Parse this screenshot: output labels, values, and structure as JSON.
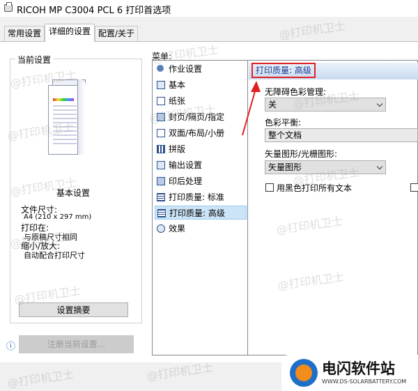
{
  "window": {
    "title": "RICOH MP C3004 PCL 6 打印首选项"
  },
  "tabs": [
    {
      "label": "常用设置",
      "active": false
    },
    {
      "label": "详细的设置",
      "active": true
    },
    {
      "label": "配置/关于",
      "active": false
    }
  ],
  "current_settings": {
    "group_title": "当前设置",
    "preview_caption": "基本设置",
    "info": [
      "文件尺寸:",
      "A4 (210 x 297 mm)",
      "打印在:",
      "与原稿尺寸相同",
      "缩小/放大:",
      "自动配合打印尺寸"
    ],
    "summary_button": "设置摘要",
    "register_button": "注册当前设置...",
    "info_icon": "ⓘ"
  },
  "menu": {
    "label": "菜单:",
    "items": [
      {
        "label": "作业设置",
        "icon": "job-icon"
      },
      {
        "label": "基本",
        "icon": "basic-icon"
      },
      {
        "label": "纸张",
        "icon": "paper-icon"
      },
      {
        "label": "封页/隔页/指定",
        "icon": "cover-icon"
      },
      {
        "label": "双面/布局/小册",
        "icon": "duplex-icon"
      },
      {
        "label": "拼版",
        "icon": "imposition-icon"
      },
      {
        "label": "输出设置",
        "icon": "output-icon"
      },
      {
        "label": "印后处理",
        "icon": "finishing-icon"
      },
      {
        "label": "打印质量: 标准",
        "icon": "quality-standard-icon"
      },
      {
        "label": "打印质量: 高级",
        "icon": "quality-advanced-icon",
        "selected": true
      },
      {
        "label": "效果",
        "icon": "effect-icon"
      }
    ]
  },
  "detail": {
    "title": "打印质量: 高级",
    "fields": [
      {
        "label": "无障碍色彩管理:",
        "value": "关"
      },
      {
        "label": "色彩平衡:",
        "value": "整个文档"
      },
      {
        "label": "矢量图形/光栅图形:",
        "value": "矢量图形"
      }
    ],
    "checkbox": {
      "label": "用黑色打印所有文本",
      "checked": false
    }
  },
  "colors": {
    "highlight_border": "#e02020",
    "selection": "#cce4f7",
    "brand_blue": "#1f6fc9",
    "brand_orange": "#f28c1a"
  },
  "watermark": {
    "text": "@打印机卫士"
  },
  "logo": {
    "name": "电闪软件站",
    "url": "WWW.DS-SOLARBATTERY.COM"
  }
}
